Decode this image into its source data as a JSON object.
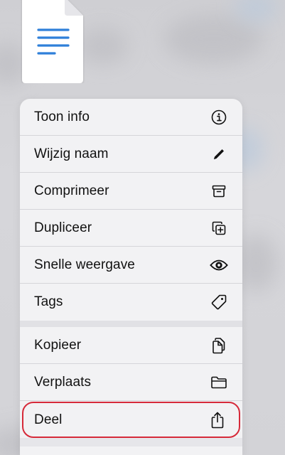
{
  "menu": {
    "items": [
      {
        "label": "Toon info",
        "icon": "info-circle-icon"
      },
      {
        "label": "Wijzig naam",
        "icon": "pencil-icon"
      },
      {
        "label": "Comprimeer",
        "icon": "archive-box-icon"
      },
      {
        "label": "Dupliceer",
        "icon": "duplicate-plus-icon"
      },
      {
        "label": "Snelle weergave",
        "icon": "eye-icon"
      },
      {
        "label": "Tags",
        "icon": "tag-icon"
      },
      {
        "label": "Kopieer",
        "icon": "copy-documents-icon"
      },
      {
        "label": "Verplaats",
        "icon": "folder-icon"
      },
      {
        "label": "Deel",
        "icon": "share-icon"
      }
    ]
  },
  "colors": {
    "highlight_ring": "#d62a3a",
    "document_lines": "#2f7fd9"
  }
}
